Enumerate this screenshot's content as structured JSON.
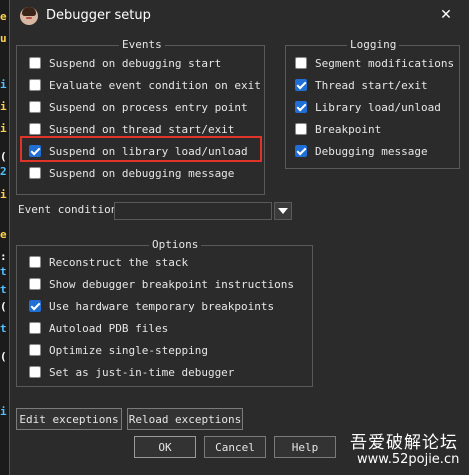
{
  "window": {
    "title": "Debugger setup",
    "close_glyph": "✕"
  },
  "background_code": [
    "e",
    "u",
    "i",
    "i",
    "i",
    "(",
    "2",
    "i",
    "e",
    "",
    ":",
    "t",
    "t",
    "",
    "e",
    "(",
    "t",
    "",
    "i"
  ],
  "events": {
    "title": "Events",
    "items": [
      {
        "label": "Suspend on debugging start",
        "checked": false
      },
      {
        "label": "Evaluate event condition on exit",
        "checked": false
      },
      {
        "label": "Suspend on process entry point",
        "checked": false
      },
      {
        "label": "Suspend on thread start/exit",
        "checked": false
      },
      {
        "label": "Suspend on library load/unload",
        "checked": true
      },
      {
        "label": "Suspend on debugging message",
        "checked": false
      }
    ]
  },
  "logging": {
    "title": "Logging",
    "items": [
      {
        "label": "Segment modifications",
        "checked": false
      },
      {
        "label": "Thread start/exit",
        "checked": true
      },
      {
        "label": "Library load/unload",
        "checked": true
      },
      {
        "label": "Breakpoint",
        "checked": false
      },
      {
        "label": "Debugging message",
        "checked": true
      }
    ]
  },
  "event_condition": {
    "label": "Event condition",
    "value": ""
  },
  "options": {
    "title": "Options",
    "items": [
      {
        "label": "Reconstruct the stack",
        "checked": false
      },
      {
        "label": "Show debugger breakpoint instructions",
        "checked": false
      },
      {
        "label": "Use hardware temporary breakpoints",
        "checked": true
      },
      {
        "label": "Autoload PDB files",
        "checked": false
      },
      {
        "label": "Optimize single-stepping",
        "checked": false
      },
      {
        "label": "Set as just-in-time debugger",
        "checked": false
      }
    ]
  },
  "buttons": {
    "edit_exceptions": "Edit exceptions",
    "reload_exceptions": "Reload exceptions",
    "ok": "OK",
    "cancel": "Cancel",
    "help": "Help"
  },
  "watermark": {
    "line1": "吾爱破解论坛",
    "line2": "www.52pojie.cn"
  },
  "colors": {
    "accent": "#1f6fd6",
    "highlight": "#e0342b",
    "background": "#2b2b2b"
  }
}
